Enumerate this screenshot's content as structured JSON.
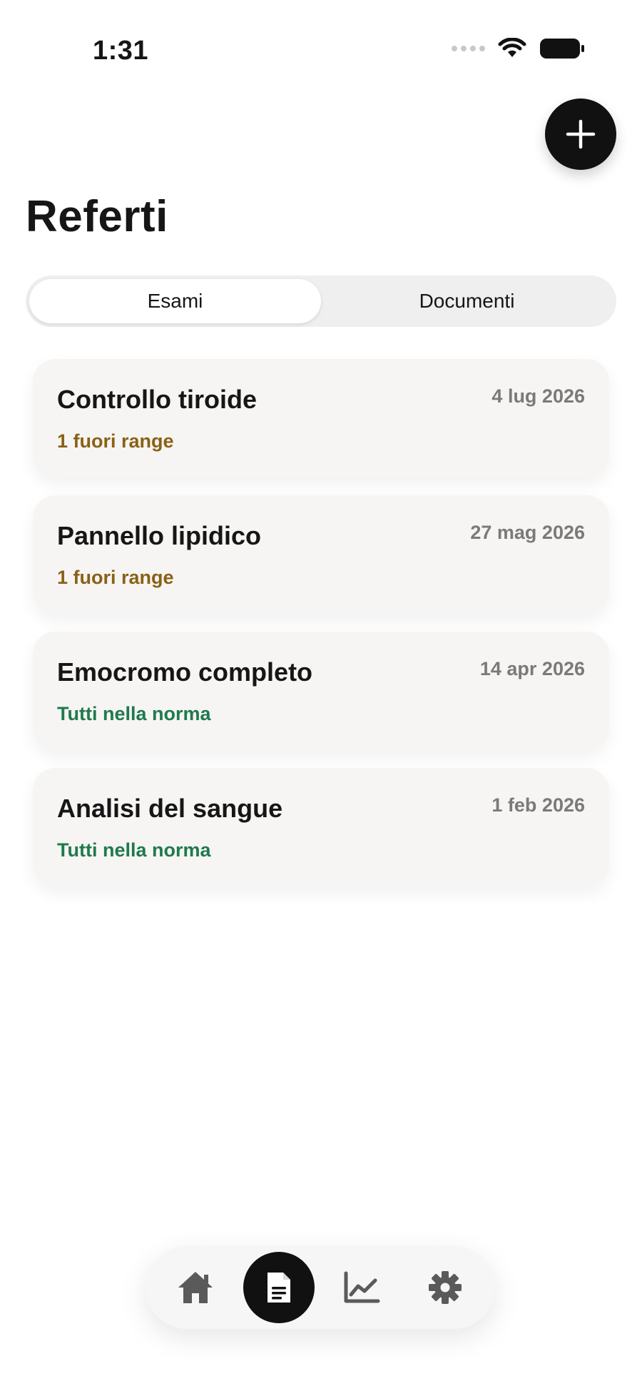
{
  "status_bar": {
    "time": "1:31"
  },
  "header": {
    "title": "Referti",
    "add_icon": "plus-icon"
  },
  "tabs": [
    {
      "label": "Esami",
      "active": true
    },
    {
      "label": "Documenti",
      "active": false
    }
  ],
  "colors": {
    "out_of_range": "#8a6116",
    "normal": "#1f7a4d",
    "accent_dark": "#111111"
  },
  "exams": [
    {
      "title": "Controllo tiroide",
      "date": "4 lug 2026",
      "status": "1 fuori range",
      "status_type": "out_of_range"
    },
    {
      "title": "Pannello lipidico",
      "date": "27 mag 2026",
      "status": "1 fuori range",
      "status_type": "out_of_range"
    },
    {
      "title": "Emocromo completo",
      "date": "14 apr 2026",
      "status": "Tutti nella norma",
      "status_type": "normal"
    },
    {
      "title": "Analisi del sangue",
      "date": "1 feb 2026",
      "status": "Tutti nella norma",
      "status_type": "normal"
    }
  ],
  "bottom_nav": [
    {
      "icon": "home-icon",
      "active": false
    },
    {
      "icon": "document-icon",
      "active": true
    },
    {
      "icon": "chart-icon",
      "active": false
    },
    {
      "icon": "gear-icon",
      "active": false
    }
  ]
}
